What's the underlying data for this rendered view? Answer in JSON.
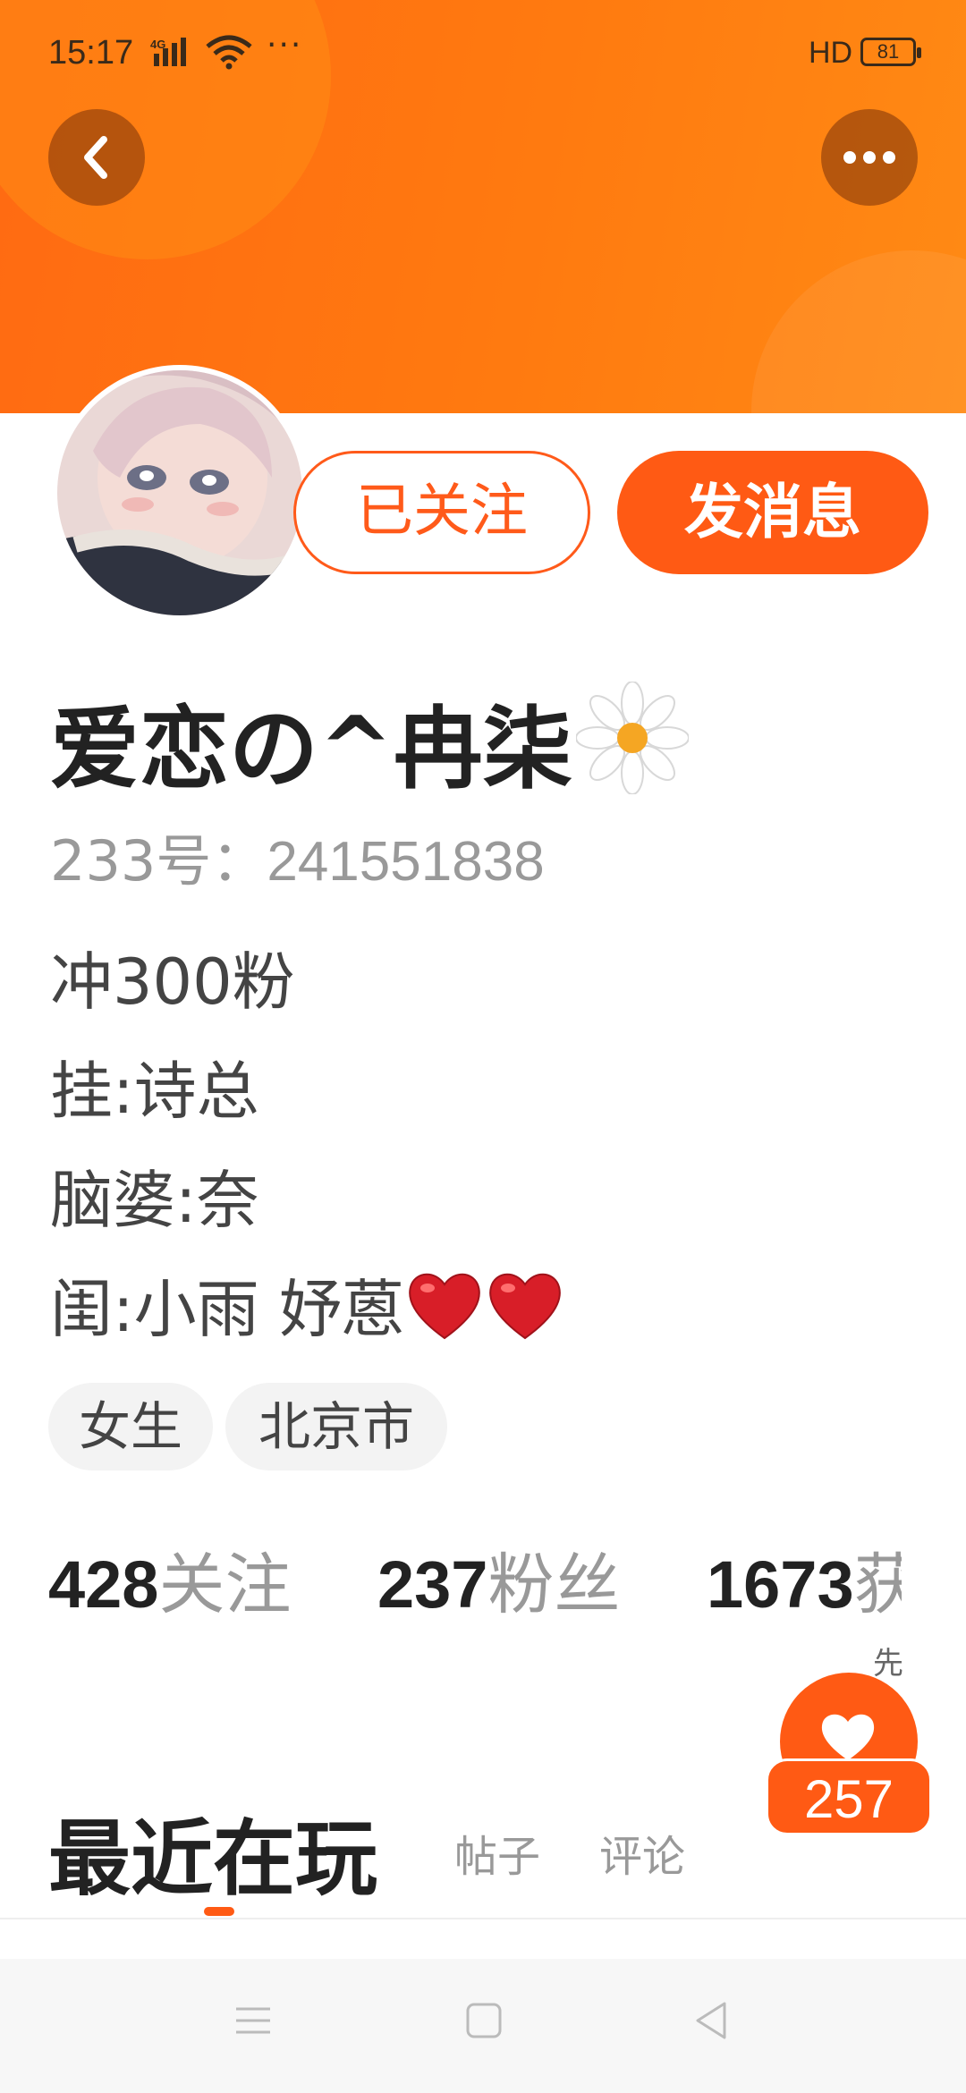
{
  "status_bar": {
    "time": "15:17",
    "network": "4G",
    "more": "···",
    "hd_label": "HD",
    "battery": "81"
  },
  "header": {
    "back_icon": "chevron-left-icon",
    "more_icon": "more-dots-icon",
    "banner_color": "#ff7010"
  },
  "profile": {
    "follow_label": "已关注",
    "message_label": "发消息",
    "nickname": "爱恋の^冉柒",
    "id_prefix": "233号：",
    "id_number": "241551838",
    "bio": [
      "冲300粉",
      "挂:诗总",
      "脑婆:奈",
      "闺:小雨 妤蒽"
    ],
    "tags": [
      "女生",
      "北京市"
    ]
  },
  "stats": [
    {
      "num": "428",
      "label": "关注"
    },
    {
      "num": "237",
      "label": "粉丝"
    },
    {
      "num": "1673",
      "label": "获"
    }
  ],
  "side_hint": "先",
  "like": {
    "count": "257"
  },
  "tabs": {
    "active": "最近在玩",
    "items": [
      "帖子",
      "评论"
    ]
  },
  "accent_color": "#ff5a14"
}
